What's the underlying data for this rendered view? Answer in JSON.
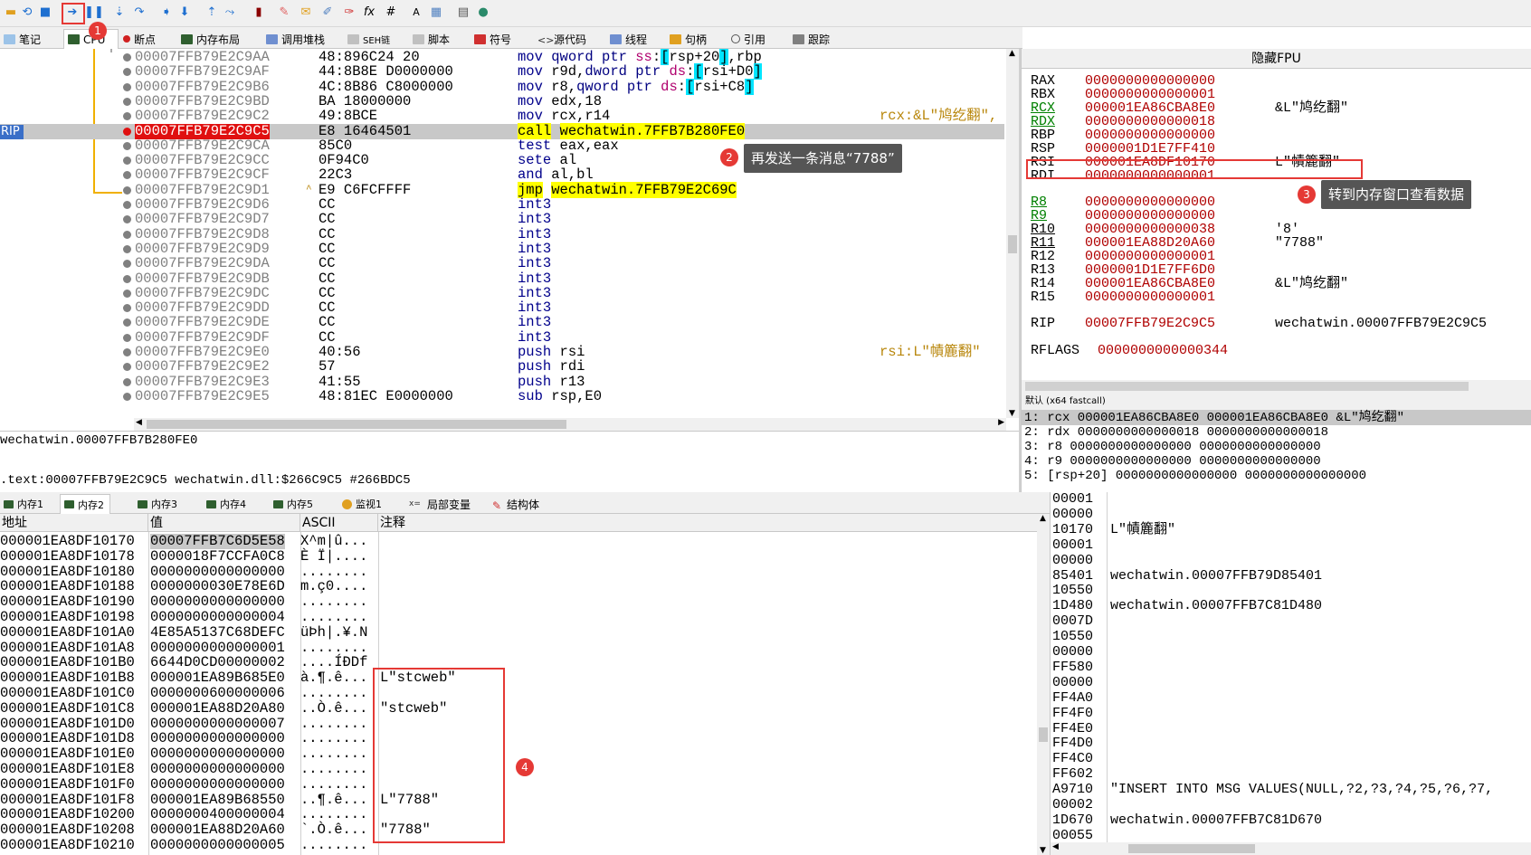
{
  "tabs": [
    {
      "label": "笔记"
    },
    {
      "label": "CPU"
    },
    {
      "label": "断点"
    },
    {
      "label": "内存布局"
    },
    {
      "label": "调用堆栈"
    },
    {
      "label": "SEH链"
    },
    {
      "label": "脚本"
    },
    {
      "label": "符号"
    },
    {
      "label": "源代码"
    },
    {
      "label": "线程"
    },
    {
      "label": "句柄"
    },
    {
      "label": "引用"
    },
    {
      "label": "跟踪"
    }
  ],
  "rip_label": "RIP",
  "disasm": [
    {
      "addr": "00007FFB79E2C9AA",
      "hex": "48:896C24 20",
      "asm": "mov qword ptr ss:[rsp+20],rbp",
      "comment": ""
    },
    {
      "addr": "00007FFB79E2C9AF",
      "hex": "44:8B8E D0000000",
      "asm": "mov r9d,dword ptr ds:[rsi+D0]",
      "comment": ""
    },
    {
      "addr": "00007FFB79E2C9B6",
      "hex": "4C:8B86 C8000000",
      "asm": "mov r8,qword ptr ds:[rsi+C8]",
      "comment": ""
    },
    {
      "addr": "00007FFB79E2C9BD",
      "hex": "BA 18000000",
      "asm": "mov edx,18",
      "comment": ""
    },
    {
      "addr": "00007FFB79E2C9C2",
      "hex": "49:8BCE",
      "asm": "mov rcx,r14",
      "comment": "rcx:&L\"鸠纥翻\","
    },
    {
      "addr": "00007FFB79E2C9C5",
      "hex": "E8 16464501",
      "asm": "call wechatwin.7FFB7B280FE0",
      "comment": ""
    },
    {
      "addr": "00007FFB79E2C9CA",
      "hex": "85C0",
      "asm": "test eax,eax",
      "comment": ""
    },
    {
      "addr": "00007FFB79E2C9CC",
      "hex": "0F94C0",
      "asm": "sete al",
      "comment": ""
    },
    {
      "addr": "00007FFB79E2C9CF",
      "hex": "22C3",
      "asm": "and al,bl",
      "comment": ""
    },
    {
      "addr": "00007FFB79E2C9D1",
      "hex": "E9 C6FCFFFF",
      "asm": "jmp wechatwin.7FFB79E2C69C",
      "comment": ""
    },
    {
      "addr": "00007FFB79E2C9D6",
      "hex": "CC",
      "asm": "int3",
      "comment": ""
    },
    {
      "addr": "00007FFB79E2C9D7",
      "hex": "CC",
      "asm": "int3",
      "comment": ""
    },
    {
      "addr": "00007FFB79E2C9D8",
      "hex": "CC",
      "asm": "int3",
      "comment": ""
    },
    {
      "addr": "00007FFB79E2C9D9",
      "hex": "CC",
      "asm": "int3",
      "comment": ""
    },
    {
      "addr": "00007FFB79E2C9DA",
      "hex": "CC",
      "asm": "int3",
      "comment": ""
    },
    {
      "addr": "00007FFB79E2C9DB",
      "hex": "CC",
      "asm": "int3",
      "comment": ""
    },
    {
      "addr": "00007FFB79E2C9DC",
      "hex": "CC",
      "asm": "int3",
      "comment": ""
    },
    {
      "addr": "00007FFB79E2C9DD",
      "hex": "CC",
      "asm": "int3",
      "comment": ""
    },
    {
      "addr": "00007FFB79E2C9DE",
      "hex": "CC",
      "asm": "int3",
      "comment": ""
    },
    {
      "addr": "00007FFB79E2C9DF",
      "hex": "CC",
      "asm": "int3",
      "comment": ""
    },
    {
      "addr": "00007FFB79E2C9E0",
      "hex": "40:56",
      "asm": "push rsi",
      "comment": "rsi:L\"幘簏翻\""
    },
    {
      "addr": "00007FFB79E2C9E2",
      "hex": "57",
      "asm": "push rdi",
      "comment": ""
    },
    {
      "addr": "00007FFB79E2C9E3",
      "hex": "41:55",
      "asm": "push r13",
      "comment": ""
    },
    {
      "addr": "00007FFB79E2C9E5",
      "hex": "48:81EC E0000000",
      "asm": "sub rsp,E0",
      "comment": ""
    }
  ],
  "info": {
    "line1": "wechatwin.00007FFB7B280FE0",
    "line2": ".text:00007FFB79E2C9C5 wechatwin.dll:$266C9C5 #266BDC5"
  },
  "regs": {
    "title": "隐藏FPU",
    "rows": [
      {
        "name": "RAX",
        "value": "0000000000000000",
        "comment": ""
      },
      {
        "name": "RBX",
        "value": "0000000000000001",
        "comment": ""
      },
      {
        "name": "RCX",
        "value": "000001EA86CBA8E0",
        "comment": "&L\"鸠纥翻\""
      },
      {
        "name": "RDX",
        "value": "0000000000000018",
        "comment": ""
      },
      {
        "name": "RBP",
        "value": "0000000000000000",
        "comment": ""
      },
      {
        "name": "RSP",
        "value": "0000001D1E7FF410",
        "comment": ""
      },
      {
        "name": "RSI",
        "value": "000001EA8DF10170",
        "comment": "L\"幘簏翻\""
      },
      {
        "name": "RDI",
        "value": "0000000000000001",
        "comment": ""
      },
      {
        "name": "R8",
        "value": "0000000000000000",
        "comment": ""
      },
      {
        "name": "R9",
        "value": "0000000000000000",
        "comment": ""
      },
      {
        "name": "R10",
        "value": "0000000000000038",
        "comment": "'8'"
      },
      {
        "name": "R11",
        "value": "000001EA88D20A60",
        "comment": "\"7788\""
      },
      {
        "name": "R12",
        "value": "0000000000000001",
        "comment": ""
      },
      {
        "name": "R13",
        "value": "0000001D1E7FF6D0",
        "comment": ""
      },
      {
        "name": "R14",
        "value": "000001EA86CBA8E0",
        "comment": "&L\"鸠纥翻\""
      },
      {
        "name": "R15",
        "value": "0000000000000001",
        "comment": ""
      },
      {
        "name": "RIP",
        "value": "00007FFB79E2C9C5",
        "comment": "wechatwin.00007FFB79E2C9C5"
      },
      {
        "name": "RFLAGS",
        "value": "0000000000000344",
        "comment": ""
      }
    ]
  },
  "callconv": {
    "header": "默认 (x64 fastcall)",
    "rows": [
      "1: rcx 000001EA86CBA8E0 000001EA86CBA8E0 &L\"鸠纥翻\"",
      "2: rdx 0000000000000018 0000000000000018",
      "3: r8 0000000000000000 0000000000000000",
      "4: r9 0000000000000000 0000000000000000",
      "5: [rsp+20] 0000000000000000 0000000000000000"
    ]
  },
  "memtabs": [
    {
      "label": "内存1"
    },
    {
      "label": "内存2"
    },
    {
      "label": "内存3"
    },
    {
      "label": "内存4"
    },
    {
      "label": "内存5"
    },
    {
      "label": "监视1"
    },
    {
      "label": "局部变量"
    },
    {
      "label": "结构体"
    }
  ],
  "dump": {
    "headers": {
      "addr": "地址",
      "value": "值",
      "ascii": "ASCII",
      "comment": "注释"
    },
    "rows": [
      {
        "addr": "000001EA8DF10170",
        "value": "00007FFB7C6D5E58",
        "ascii": "X^m|û...",
        "comment": ""
      },
      {
        "addr": "000001EA8DF10178",
        "value": "0000018F7CCFA0C8",
        "ascii": "È Ï|....",
        "comment": ""
      },
      {
        "addr": "000001EA8DF10180",
        "value": "0000000000000000",
        "ascii": "........",
        "comment": ""
      },
      {
        "addr": "000001EA8DF10188",
        "value": "0000000030E78E6D",
        "ascii": "m.ç0....",
        "comment": ""
      },
      {
        "addr": "000001EA8DF10190",
        "value": "0000000000000000",
        "ascii": "........",
        "comment": ""
      },
      {
        "addr": "000001EA8DF10198",
        "value": "0000000000000004",
        "ascii": "........",
        "comment": ""
      },
      {
        "addr": "000001EA8DF101A0",
        "value": "4E85A5137C68DEFC",
        "ascii": "üÞh|.¥.N",
        "comment": ""
      },
      {
        "addr": "000001EA8DF101A8",
        "value": "0000000000000001",
        "ascii": "........",
        "comment": ""
      },
      {
        "addr": "000001EA8DF101B0",
        "value": "6644D0CD00000002",
        "ascii": "....ÍÐDf",
        "comment": ""
      },
      {
        "addr": "000001EA8DF101B8",
        "value": "000001EA89B685E0",
        "ascii": "à.¶.ê...",
        "comment": "L\"stcweb\""
      },
      {
        "addr": "000001EA8DF101C0",
        "value": "0000000600000006",
        "ascii": "........",
        "comment": ""
      },
      {
        "addr": "000001EA8DF101C8",
        "value": "000001EA88D20A80",
        "ascii": "..Ò.ê...",
        "comment": "\"stcweb\""
      },
      {
        "addr": "000001EA8DF101D0",
        "value": "0000000000000007",
        "ascii": "........",
        "comment": ""
      },
      {
        "addr": "000001EA8DF101D8",
        "value": "0000000000000000",
        "ascii": "........",
        "comment": ""
      },
      {
        "addr": "000001EA8DF101E0",
        "value": "0000000000000000",
        "ascii": "........",
        "comment": ""
      },
      {
        "addr": "000001EA8DF101E8",
        "value": "0000000000000000",
        "ascii": "........",
        "comment": ""
      },
      {
        "addr": "000001EA8DF101F0",
        "value": "0000000000000000",
        "ascii": "........",
        "comment": ""
      },
      {
        "addr": "000001EA8DF101F8",
        "value": "000001EA89B68550",
        "ascii": "..¶.ê...",
        "comment": "L\"7788\""
      },
      {
        "addr": "000001EA8DF10200",
        "value": "0000000400000004",
        "ascii": "........",
        "comment": ""
      },
      {
        "addr": "000001EA8DF10208",
        "value": "000001EA88D20A60",
        "ascii": "`.Ò.ê...",
        "comment": "\"7788\""
      },
      {
        "addr": "000001EA8DF10210",
        "value": "0000000000000005",
        "ascii": "........",
        "comment": ""
      }
    ]
  },
  "stack": [
    {
      "addr": "00001",
      "comment": ""
    },
    {
      "addr": "00000",
      "comment": ""
    },
    {
      "addr": "10170",
      "comment": "L\"幘簏翻\""
    },
    {
      "addr": "00001",
      "comment": ""
    },
    {
      "addr": "00000",
      "comment": ""
    },
    {
      "addr": "85401",
      "comment": "wechatwin.00007FFB79D85401"
    },
    {
      "addr": "10550",
      "comment": ""
    },
    {
      "addr": "1D480",
      "comment": "wechatwin.00007FFB7C81D480"
    },
    {
      "addr": "0007D",
      "comment": ""
    },
    {
      "addr": "10550",
      "comment": ""
    },
    {
      "addr": "00000",
      "comment": ""
    },
    {
      "addr": "FF580",
      "comment": ""
    },
    {
      "addr": "00000",
      "comment": ""
    },
    {
      "addr": "FF4A0",
      "comment": ""
    },
    {
      "addr": "FF4F0",
      "comment": ""
    },
    {
      "addr": "FF4E0",
      "comment": ""
    },
    {
      "addr": "FF4D0",
      "comment": ""
    },
    {
      "addr": "FF4C0",
      "comment": ""
    },
    {
      "addr": "FF602",
      "comment": ""
    },
    {
      "addr": "A9710",
      "comment": "\"INSERT INTO MSG VALUES(NULL,?2,?3,?4,?5,?6,?7,"
    },
    {
      "addr": "00002",
      "comment": ""
    },
    {
      "addr": "1D670",
      "comment": "wechatwin.00007FFB7C81D670"
    },
    {
      "addr": "00055",
      "comment": ""
    }
  ],
  "annotations": {
    "tip2": "再发送一条消息“7788”",
    "tip3": "转到内存窗口查看数据",
    "n1": "1",
    "n2": "2",
    "n3": "3",
    "n4": "4"
  }
}
